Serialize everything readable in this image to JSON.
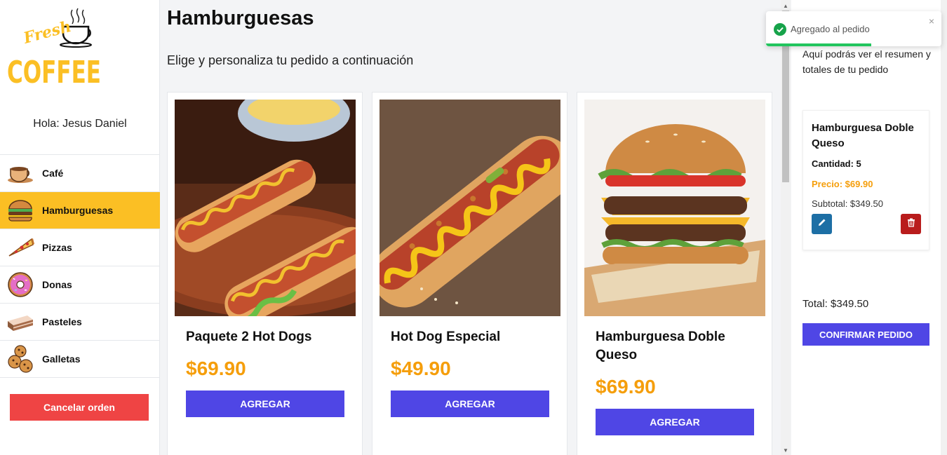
{
  "sidebar": {
    "logo_word_top": "Fresh",
    "logo_word_main": "COFFEE",
    "greeting": "Hola: Jesus Daniel",
    "categories": [
      {
        "label": "Café",
        "icon": "coffee-cup-icon",
        "active": false
      },
      {
        "label": "Hamburguesas",
        "icon": "burger-icon",
        "active": true
      },
      {
        "label": "Pizzas",
        "icon": "pizza-icon",
        "active": false
      },
      {
        "label": "Donas",
        "icon": "donut-icon",
        "active": false
      },
      {
        "label": "Pasteles",
        "icon": "cake-icon",
        "active": false
      },
      {
        "label": "Galletas",
        "icon": "cookie-icon",
        "active": false
      }
    ],
    "cancel_label": "Cancelar orden"
  },
  "main": {
    "title": "Hamburguesas",
    "subtitle": "Elige y personaliza tu pedido a continuación",
    "products": [
      {
        "name": "Paquete 2 Hot Dogs",
        "price": "$69.90",
        "button": "AGREGAR"
      },
      {
        "name": "Hot Dog Especial",
        "price": "$49.90",
        "button": "AGREGAR"
      },
      {
        "name": "Hamburguesa Doble Queso",
        "price": "$69.90",
        "button": "AGREGAR"
      }
    ]
  },
  "order": {
    "description": "Aquí podrás ver el resumen y totales de tu pedido",
    "item": {
      "name": "Hamburguesa Doble Queso",
      "quantity": "Cantidad: 5",
      "price": "Precio: $69.90",
      "subtotal": "Subtotal: $349.50"
    },
    "total": "Total: $349.50",
    "confirm_label": "CONFIRMAR PEDIDO"
  },
  "toast": {
    "message": "Agregado al pedido",
    "close": "×",
    "progress": 0.6
  },
  "colors": {
    "accent": "#fbbf24",
    "primary": "#4f46e5",
    "danger": "#ef4444",
    "price": "#f59e0b"
  }
}
